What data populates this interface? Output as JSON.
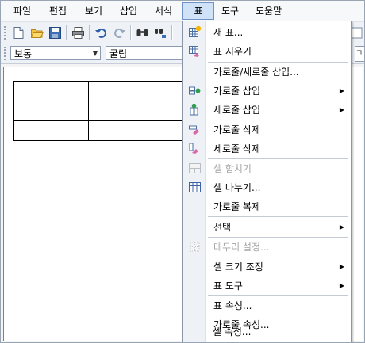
{
  "menubar": {
    "items": [
      "파일",
      "편집",
      "보기",
      "삽입",
      "서식",
      "표",
      "도구",
      "도움말"
    ]
  },
  "formatbar": {
    "style_value": "보통",
    "font_value": "굴림",
    "right_partial": "ㄱ"
  },
  "table_menu": {
    "items": [
      {
        "label": "새 표...",
        "icon": "new-table-icon",
        "enabled": true,
        "submenu": false
      },
      {
        "label": "표 지우기",
        "icon": "erase-table-icon",
        "enabled": true,
        "submenu": false
      },
      {
        "label": "가로줄/세로줄 삽입...",
        "icon": "",
        "enabled": true,
        "submenu": false
      },
      {
        "label": "가로줄 삽입",
        "icon": "insert-row-icon",
        "enabled": true,
        "submenu": true
      },
      {
        "label": "세로줄 삽입",
        "icon": "insert-column-icon",
        "enabled": true,
        "submenu": true
      },
      {
        "label": "가로줄 삭제",
        "icon": "delete-row-icon",
        "enabled": true,
        "submenu": false
      },
      {
        "label": "세로줄 삭제",
        "icon": "delete-column-icon",
        "enabled": true,
        "submenu": false
      },
      {
        "label": "셀 합치기",
        "icon": "merge-cells-icon",
        "enabled": false,
        "submenu": false
      },
      {
        "label": "셀 나누기...",
        "icon": "split-cells-icon",
        "enabled": true,
        "submenu": false
      },
      {
        "label": "가로줄 복제",
        "icon": "",
        "enabled": true,
        "submenu": false
      },
      {
        "label": "선택",
        "icon": "",
        "enabled": true,
        "submenu": true
      },
      {
        "label": "테두리 설정...",
        "icon": "border-settings-icon",
        "enabled": false,
        "submenu": false
      },
      {
        "label": "셀 크기 조정",
        "icon": "",
        "enabled": true,
        "submenu": true
      },
      {
        "label": "표 도구",
        "icon": "",
        "enabled": true,
        "submenu": true
      },
      {
        "label": "표 속성...",
        "icon": "",
        "enabled": true,
        "submenu": false
      },
      {
        "label": "가로줄 속성...",
        "icon": "",
        "enabled": true,
        "submenu": false
      },
      {
        "label": "셀 속성...",
        "icon": "",
        "enabled": true,
        "submenu": false
      }
    ]
  },
  "colors": {
    "menu_active_bg": "#cfe2f7",
    "menu_gutter": "#eef1f6",
    "disabled_text": "#a6a6a6"
  }
}
